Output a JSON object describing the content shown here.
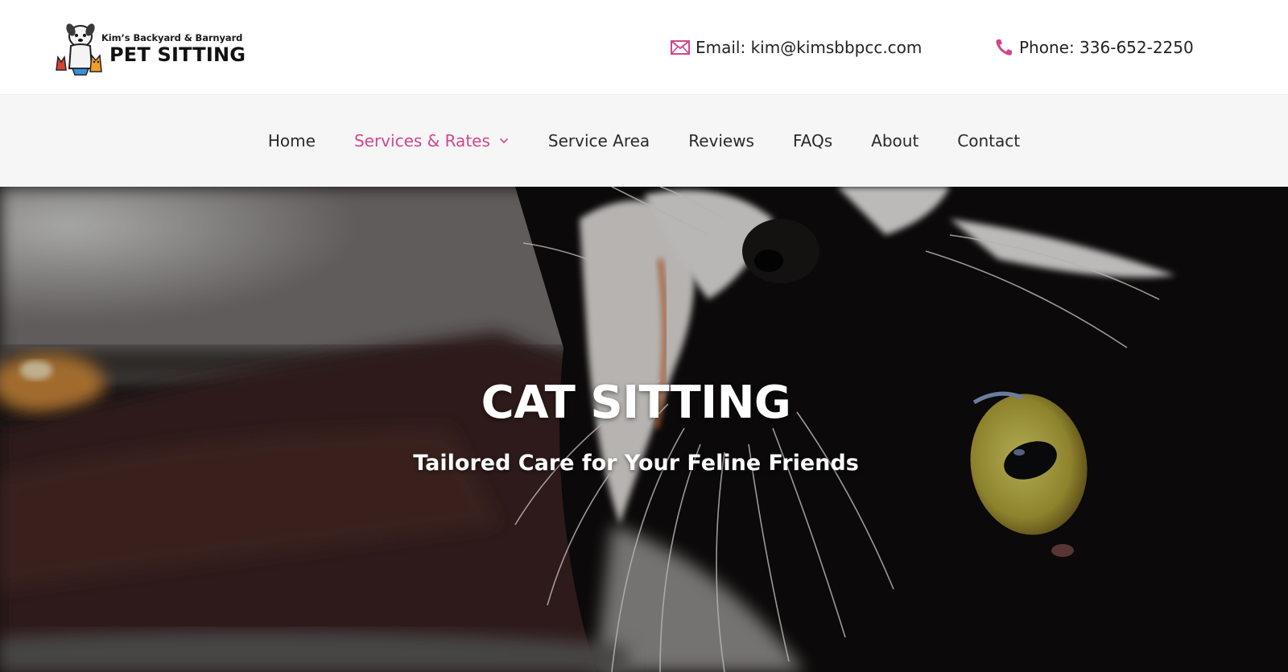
{
  "header": {
    "logo": {
      "line1": "Kim’s Backyard & Barnyard",
      "line2": "PET SITTING",
      "icon": "dog-and-cats-logo"
    },
    "email": {
      "icon": "envelope-icon",
      "text": "Email: kim@kimsbbpcc.com"
    },
    "phone": {
      "icon": "phone-icon",
      "text": "Phone: 336-652-2250"
    },
    "accent_color": "#d2468f"
  },
  "nav": {
    "items": [
      {
        "label": "Home",
        "active": false
      },
      {
        "label": "Services & Rates",
        "active": true,
        "dropdown": true
      },
      {
        "label": "Service Area",
        "active": false
      },
      {
        "label": "Reviews",
        "active": false
      },
      {
        "label": "FAQs",
        "active": false
      },
      {
        "label": "About",
        "active": false
      },
      {
        "label": "Contact",
        "active": false
      }
    ]
  },
  "hero": {
    "title": "CAT SITTING",
    "subtitle": "Tailored Care for Your Feline Friends",
    "image": "black-and-white-cat-photo"
  }
}
